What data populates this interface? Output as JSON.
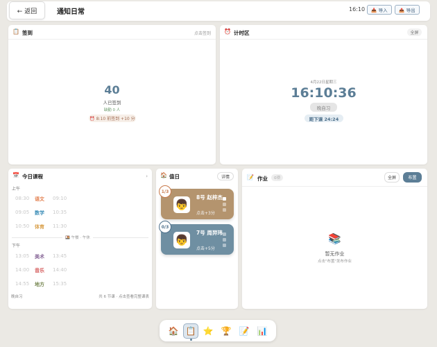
{
  "header": {
    "back_label": "← 返回",
    "title": "通知日常",
    "time": "16:10",
    "import_label": "📥 导入",
    "export_label": "📤 导出"
  },
  "signin": {
    "title": "签到",
    "action": "点击签到",
    "count": "40",
    "count_label": "人已签到",
    "leave": "缺勤 0 人",
    "note": "⏰ 8:10 前签到 +10 分"
  },
  "timer": {
    "title": "计时区",
    "fullscreen": "全屏",
    "date": "4月22日星期三",
    "time": "16:10:36",
    "session": "晚自习",
    "remaining": "距下课 24:24"
  },
  "schedule": {
    "title": "今日课程",
    "morning": "上午",
    "afternoon": "下午",
    "break_label": "🍱 午餐 · 午休",
    "morning_rows": [
      {
        "start": "08:30",
        "subject": "语文",
        "end": "09:10",
        "color": "#e27d4b"
      },
      {
        "start": "09:05",
        "subject": "数学",
        "end": "10:35",
        "color": "#3f8fb8"
      },
      {
        "start": "10:50",
        "subject": "体育",
        "end": "11:30",
        "color": "#d9a04b"
      }
    ],
    "afternoon_rows": [
      {
        "start": "13:05",
        "subject": "美术",
        "end": "13:45",
        "color": "#8a6a9a"
      },
      {
        "start": "14:00",
        "subject": "音乐",
        "end": "14:40",
        "color": "#d45a5a"
      },
      {
        "start": "14:55",
        "subject": "地方",
        "end": "15:35",
        "color": "#7a8a55"
      }
    ],
    "footer_left": "晚自习",
    "footer_right": "共 6 节课 · 点击查看完整课表"
  },
  "duty": {
    "title": "值日",
    "detail": "详情",
    "cards": [
      {
        "badge": "1/3",
        "name": "8号 赵梓杰",
        "points": "点击+3分",
        "color": "#b4946e",
        "badge_color": "#c8794a"
      },
      {
        "badge": "0/3",
        "name": "7号 周羿玮",
        "points": "点击+5分",
        "color": "#6f8fa2",
        "badge_color": "#4d6f8a"
      }
    ]
  },
  "homework": {
    "title": "作业",
    "tag": "0项",
    "fullscreen": "全屏",
    "publish": "布置",
    "empty_title": "暂无作业",
    "empty_hint": "点击\"布置\"发布作业"
  },
  "dock": {
    "icons": [
      "house-icon",
      "checklist-icon",
      "star-icon",
      "trophy-icon",
      "memo-icon",
      "chart-icon"
    ]
  },
  "colors": {
    "accent": "#5c7e96",
    "page_bg": "#ebe9e4"
  }
}
